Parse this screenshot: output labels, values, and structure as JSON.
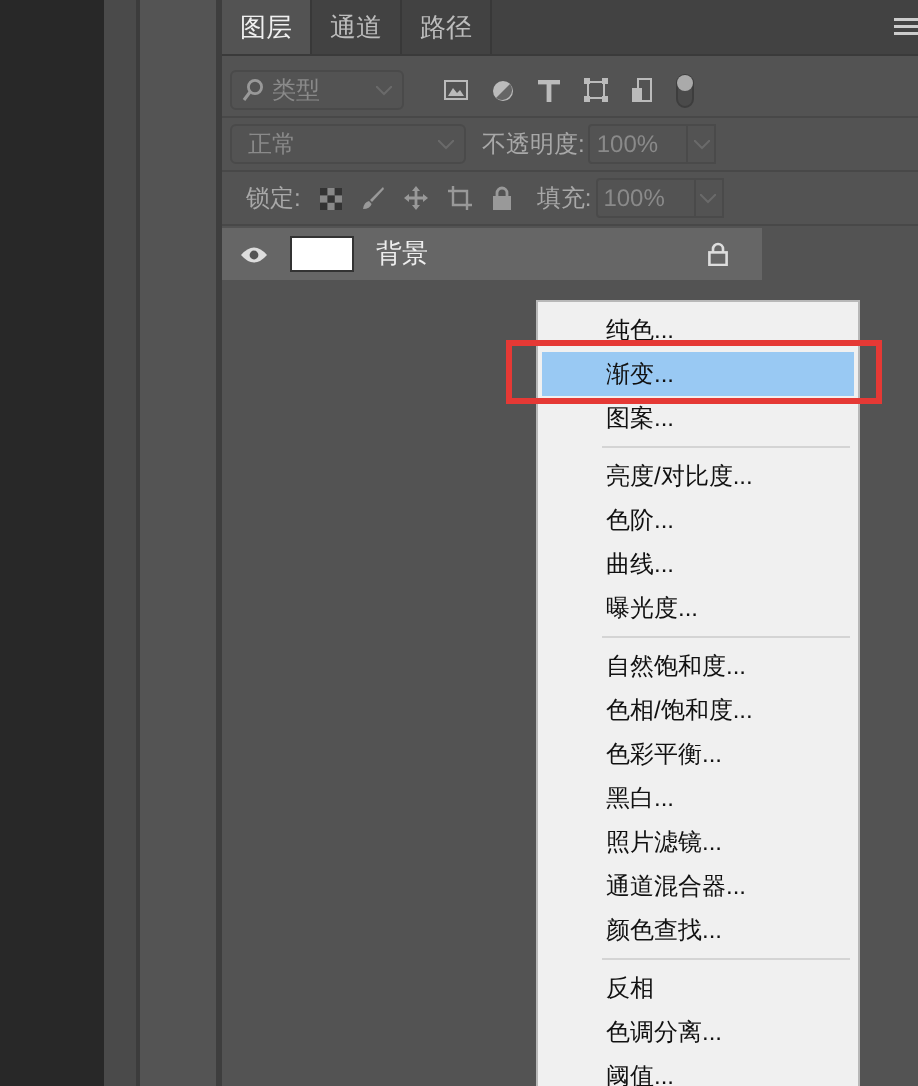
{
  "tabs": [
    {
      "label": "图层",
      "selected": true
    },
    {
      "label": "通道",
      "selected": false
    },
    {
      "label": "路径",
      "selected": false
    }
  ],
  "filter": {
    "value": "类型",
    "disabled": true,
    "on": false
  },
  "blend": {
    "value": "正常",
    "disabled": true
  },
  "opacity": {
    "label": "不透明度:",
    "value": "100%",
    "disabled": true
  },
  "lock": {
    "label": "锁定:"
  },
  "fill": {
    "label": "填充:",
    "value": "100%",
    "disabled": true
  },
  "layers": [
    {
      "name": "背景",
      "visible": true,
      "locked": true
    }
  ],
  "menu": {
    "groups": [
      [
        {
          "label": "纯色...",
          "selected": false
        },
        {
          "label": "渐变...",
          "selected": true
        },
        {
          "label": "图案...",
          "selected": false
        }
      ],
      [
        {
          "label": "亮度/对比度...",
          "selected": false
        },
        {
          "label": "色阶...",
          "selected": false
        },
        {
          "label": "曲线...",
          "selected": false
        },
        {
          "label": "曝光度...",
          "selected": false
        }
      ],
      [
        {
          "label": "自然饱和度...",
          "selected": false
        },
        {
          "label": "色相/饱和度...",
          "selected": false
        },
        {
          "label": "色彩平衡...",
          "selected": false
        },
        {
          "label": "黑白...",
          "selected": false
        },
        {
          "label": "照片滤镜...",
          "selected": false
        },
        {
          "label": "通道混合器...",
          "selected": false
        },
        {
          "label": "颜色查找...",
          "selected": false
        }
      ],
      [
        {
          "label": "反相",
          "selected": false
        },
        {
          "label": "色调分离...",
          "selected": false
        },
        {
          "label": "阈值...",
          "selected": false
        }
      ]
    ]
  }
}
